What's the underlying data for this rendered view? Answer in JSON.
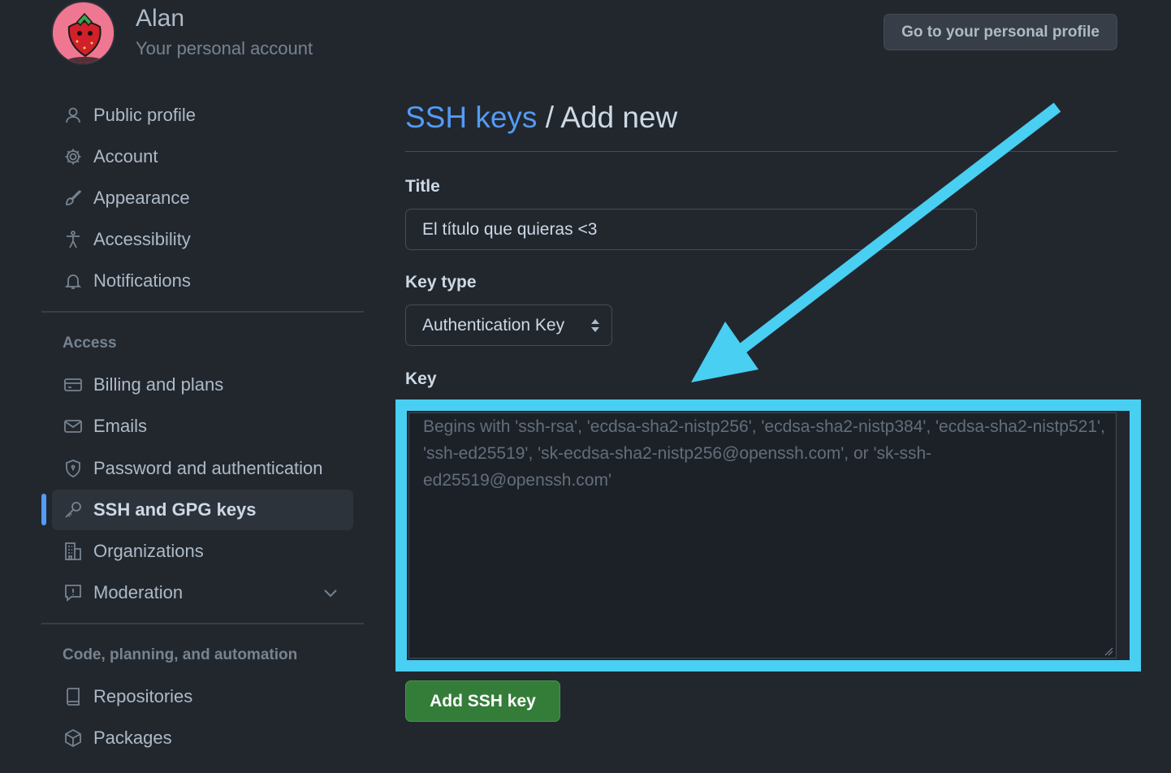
{
  "header": {
    "name": "Alan",
    "subtitle": "Your personal account",
    "profile_button": "Go to your personal profile"
  },
  "sidebar": {
    "items_top": [
      {
        "label": "Public profile",
        "icon": "person-icon"
      },
      {
        "label": "Account",
        "icon": "gear-icon"
      },
      {
        "label": "Appearance",
        "icon": "paintbrush-icon"
      },
      {
        "label": "Accessibility",
        "icon": "accessibility-icon"
      },
      {
        "label": "Notifications",
        "icon": "bell-icon"
      }
    ],
    "access_label": "Access",
    "items_access": [
      {
        "label": "Billing and plans",
        "icon": "credit-card-icon"
      },
      {
        "label": "Emails",
        "icon": "mail-icon"
      },
      {
        "label": "Password and authentication",
        "icon": "shield-lock-icon"
      },
      {
        "label": "SSH and GPG keys",
        "icon": "key-icon",
        "active": true
      },
      {
        "label": "Organizations",
        "icon": "organization-icon"
      },
      {
        "label": "Moderation",
        "icon": "report-icon"
      }
    ],
    "code_label": "Code, planning, and automation",
    "items_code": [
      {
        "label": "Repositories",
        "icon": "repo-icon"
      },
      {
        "label": "Packages",
        "icon": "package-icon"
      }
    ]
  },
  "main": {
    "breadcrumb_link": "SSH keys",
    "breadcrumb_rest": " / Add new",
    "title_label": "Title",
    "title_value": "El título que quieras <3",
    "key_type_label": "Key type",
    "key_type_value": "Authentication Key",
    "key_label": "Key",
    "key_placeholder": "Begins with 'ssh-rsa', 'ecdsa-sha2-nistp256', 'ecdsa-sha2-nistp384', 'ecdsa-sha2-nistp521', 'ssh-ed25519', 'sk-ecdsa-sha2-nistp256@openssh.com', or 'sk-ssh-ed25519@openssh.com'",
    "submit_label": "Add SSH key"
  },
  "colors": {
    "background": "#22272e",
    "accent_link": "#539bf5",
    "annotation": "#48cff2",
    "submit_green": "#347d39"
  }
}
